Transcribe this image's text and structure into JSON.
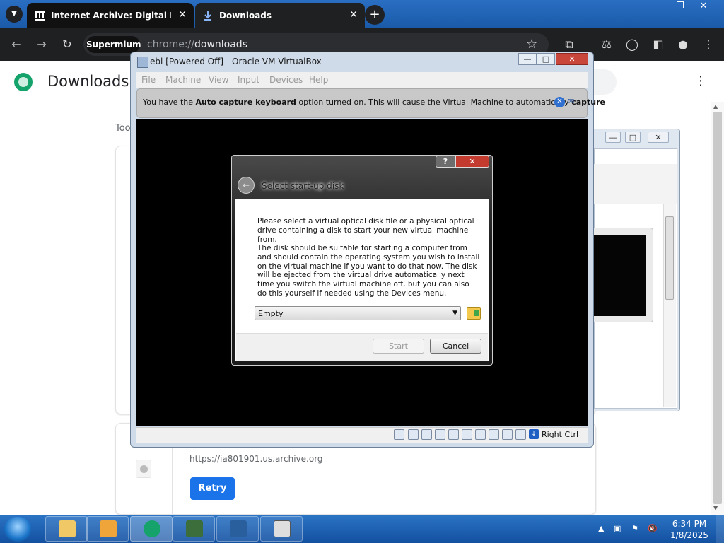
{
  "browser": {
    "tabs": [
      {
        "label": "Internet Archive: Digital Librar",
        "icon": "archive-icon"
      },
      {
        "label": "Downloads",
        "icon": "download-icon"
      }
    ],
    "chip_label": "Supermium",
    "url_scheme": "chrome://",
    "url_host": "downloads"
  },
  "downloads_page": {
    "title": "Downloads",
    "section_label": "Too",
    "item_url": "https://ia801901.us.archive.org",
    "retry_label": "Retry"
  },
  "vm_window": {
    "title": "ebl [Powered Off] - Oracle VM VirtualBox",
    "menu": [
      "File",
      "Machine",
      "View",
      "Input",
      "Devices",
      "Help"
    ],
    "notice": {
      "prefix": "You have the ",
      "bold1": "Auto capture keyboard",
      "middle": " option turned on. This will cause the Virtual Machine to automatically ",
      "bold2": "capture"
    },
    "host_key": "Right Ctrl"
  },
  "dialog": {
    "title": "Select start-up disk",
    "text1": "Please select a virtual optical disk file or a physical optical drive containing a disk to start your new virtual machine from.",
    "text2": "The disk should be suitable for starting a computer from and should contain the operating system you wish to install on the virtual machine if you want to do that now. The disk will be ejected from the virtual drive automatically next time you switch the virtual machine off, but you can also do this yourself if needed using the Devices menu.",
    "combo_value": "Empty",
    "start_label": "Start",
    "cancel_label": "Cancel",
    "help_label": "?"
  },
  "taskbar": {
    "time": "6:34 PM",
    "date": "1/8/2025"
  },
  "colors": {
    "accent_blue": "#1a73e8",
    "chrome_dark": "#1f2022",
    "win7_taskbar": "#1b5ab0"
  }
}
